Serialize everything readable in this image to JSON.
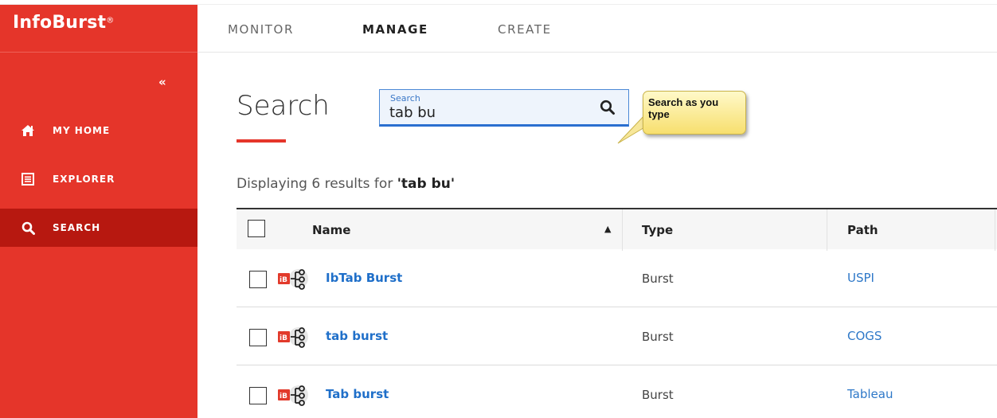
{
  "app": {
    "logo": "InfoBurst",
    "logo_mark": "®",
    "collapse": "«"
  },
  "sidebar": {
    "items": [
      {
        "label": "MY HOME",
        "icon": "home-icon"
      },
      {
        "label": "EXPLORER",
        "icon": "list-icon"
      },
      {
        "label": "SEARCH",
        "icon": "search-icon",
        "active": true
      }
    ]
  },
  "topnav": {
    "tabs": [
      {
        "label": "MONITOR"
      },
      {
        "label": "MANAGE",
        "active": true
      },
      {
        "label": "CREATE"
      }
    ]
  },
  "main": {
    "title": "Search",
    "search": {
      "label": "Search",
      "value": "tab bu"
    },
    "callout": "Search as you type",
    "results_prefix": "Displaying 6 results for ",
    "results_query": "'tab bu'"
  },
  "table": {
    "columns": {
      "name": "Name",
      "type": "Type",
      "path": "Path"
    },
    "sort_indicator": "▲",
    "rows": [
      {
        "name": "IbTab Burst",
        "type": "Burst",
        "path": "USPI"
      },
      {
        "name": "tab burst",
        "type": "Burst",
        "path": "COGS"
      },
      {
        "name": "Tab burst",
        "type": "Burst",
        "path": "Tableau"
      }
    ]
  },
  "colors": {
    "brand_red": "#e5352a",
    "active_red": "#b71810",
    "link_blue": "#1f6fc9"
  }
}
